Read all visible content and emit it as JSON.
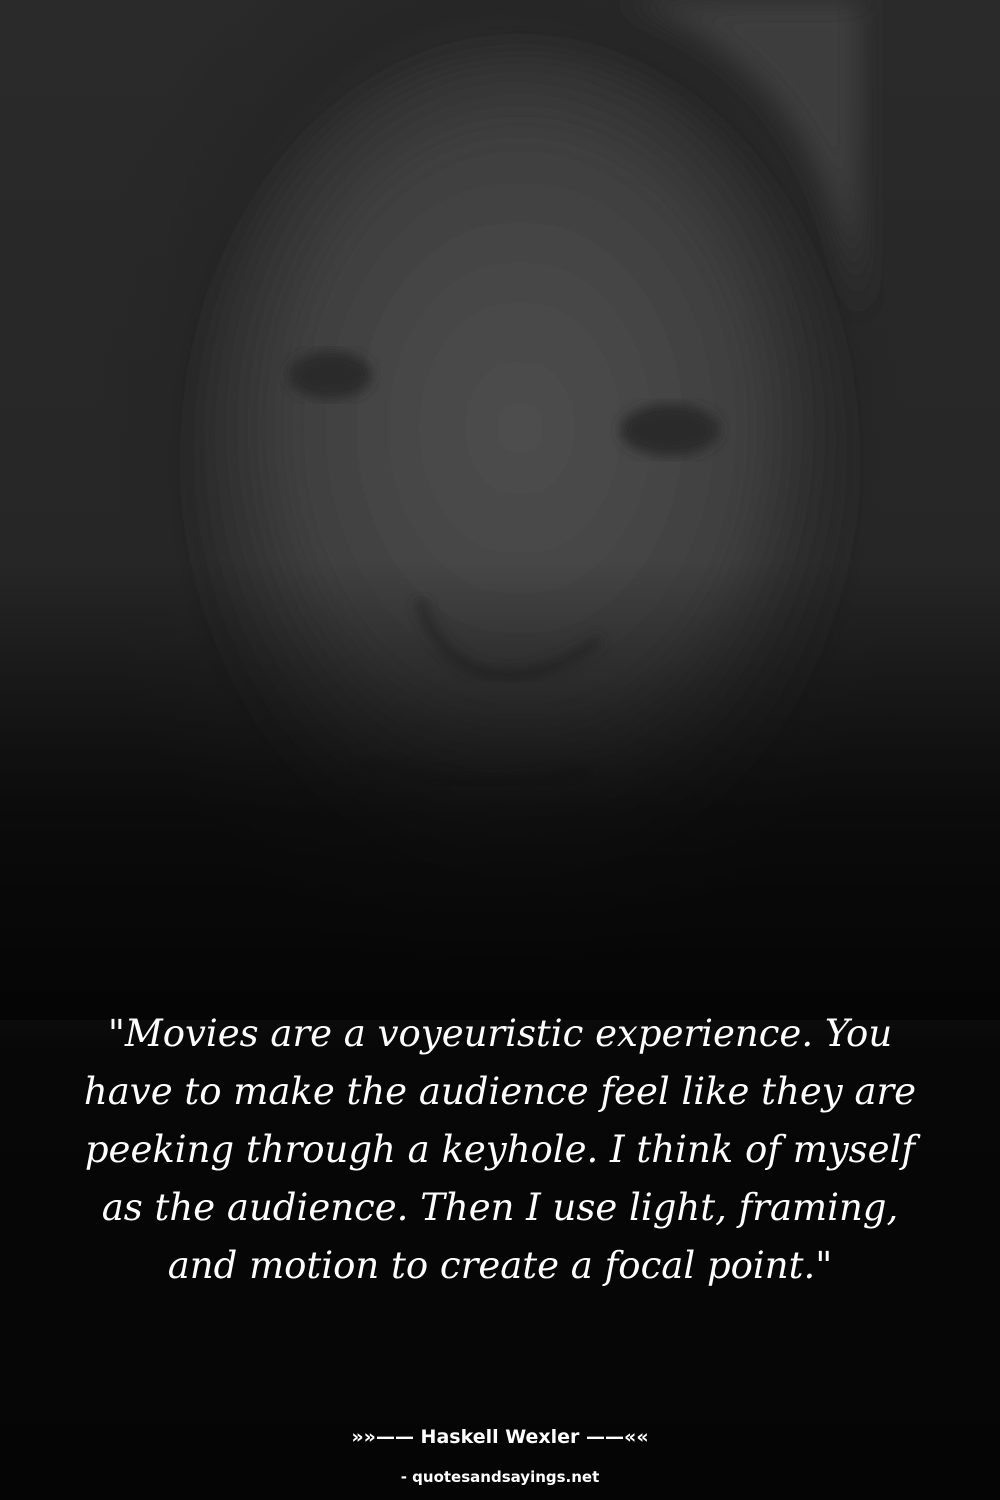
{
  "background": {
    "subject": "portrait-photo",
    "tone": "dark-grayscale"
  },
  "quote": {
    "text": "\"Movies are a voyeuristic experience. You have to make the audience feel like they are peeking through a keyhole. I think of myself as the audience. Then I use light, framing, and motion to create a focal point.\""
  },
  "attribution": {
    "author_line": "»»—— Haskell Wexler ——««"
  },
  "watermark": {
    "text": "- quotesandsayings.net"
  },
  "colors": {
    "text": "#ffffff",
    "background": "#050505"
  }
}
